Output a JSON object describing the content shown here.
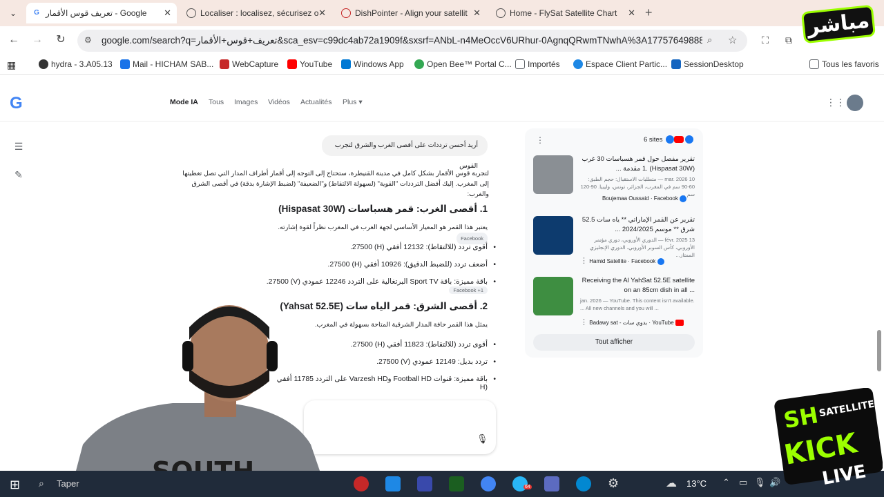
{
  "tabs": [
    {
      "title": "تعريف قوس الأقمار - Google Search",
      "display": "تعريف قوس الأقمار - Google",
      "active": true
    },
    {
      "title": "Localiser : localisez, sécurisez o",
      "active": false
    },
    {
      "title": "DishPointer - Align your satellit",
      "active": false
    },
    {
      "title": "Home - FlySat Satellite Chart",
      "active": false
    }
  ],
  "toolbar": {
    "url": "google.com/search?q=تعريف+قوس+الأقمار&sca_esv=c99dc4ab72a1909f&sxsrf=ANbL-n4MeOccV6URhur-0AgnqQRwmTNwhA%3A1775764988835..."
  },
  "bookmarks": [
    {
      "label": "hydra - 3.A05.13",
      "color": "#333333"
    },
    {
      "label": "Mail - HICHAM SAB...",
      "color": "#1a73e8"
    },
    {
      "label": "WebCapture",
      "color": "#c62828"
    },
    {
      "label": "YouTube",
      "color": "#ff0000"
    },
    {
      "label": "Windows App",
      "color": "#0078d4"
    },
    {
      "label": "Open Bee™ Portal C...",
      "color": "#34a853"
    },
    {
      "label": "Importés",
      "color": "#5f6368"
    },
    {
      "label": "Espace Client Partic...",
      "color": "#1e88e5"
    },
    {
      "label": "SessionDesktop",
      "color": "#1565c0"
    }
  ],
  "bookmarks_all": "Tous les favoris",
  "google": {
    "tabs": [
      "Mode IA",
      "Tous",
      "Images",
      "Vidéos",
      "Actualités",
      "Plus"
    ]
  },
  "content": {
    "prompt": "أريد أحسن ترددات على أقصى الغرب والشرق لتجرب القوس",
    "intro": "لتجربة قوس الأقمار بشكل كامل في مدينة القنيطرة، ستحتاج إلى التوجه إلى أقمار أطراف المدار التي تصل تغطيتها إلى المغرب. إليك أفضل الترددات \"القوية\" (لسهولة الالتقاط) و\"الضعيفة\" (لضبط الإشارة بدقة) في أقصى الشرق والغرب:",
    "section1_title": "1. أقصى الغرب: قمر هسباسات (Hispasat 30W)",
    "section1_desc": "يعتبر هذا القمر هو المعيار الأساسي لجهة الغرب في المغرب نظراً لقوة إشارته.",
    "section1_items": [
      "أقوى تردد (للالتقاط): 12132 أفقي (H) 27500.",
      "أضعف تردد (للضبط الدقيق): 10926 أفقي (H) 27500.",
      "باقة مميزة: باقة Sport TV البرتغالية على التردد 12246 عمودي (V) 27500."
    ],
    "section2_title": "2. أقصى الشرق: قمر الياه سات (Yahsat 52.5E)",
    "section2_desc": "يمثل هذا القمر حافة المدار الشرقية المتاحة بسهولة في المغرب.",
    "section2_items": [
      "أقوى تردد (للالتقاط): 11823 أفقي (H) 27500.",
      "تردد بديل: 12149 عمودي (V) 27500.",
      "باقة مميزة: قنوات Football HD وVarzesh HD على التردد 11785 أفقي (H"
    ],
    "chip1": "Facebook",
    "chip2": "Facebook +1"
  },
  "panel": {
    "sites_label": "6 sites",
    "cards": [
      {
        "title": "تقرير مفصل حول قمر هسباسات 30 غرب (Hispasat 30W) .1 مقدمة ...",
        "snippet": "10 mar. 2026 — متطلبات الاستقبال: حجم الطبق: 60-90 سم في المغرب، الجزائر، تونس، وليبيا. 90-120 سم ...",
        "source": "Boujemaa Oussaid · Facebook"
      },
      {
        "title": "تقرير عن القمر الإماراتي ** ياه سات 52.5 شرق ** موسم 2024/2025 ...",
        "snippet": "13 févr. 2025 — الدوري الأوروبي، دوري مؤتمر الأوروبي، كأس السوبر الأوروبي، الدوري الإنجليزي الممتاز...",
        "source": "Hamid Satellite · Facebook"
      },
      {
        "title": "Receiving the Al YahSat 52.5E satellite on an 85cm dish in all ...",
        "snippet": "jan. 2026 — YouTube. This content isn't available. ... All new channels and you will ...",
        "source": "Badawy sat - بدوي سات · YouTube"
      }
    ],
    "show_all": "Tout afficher"
  },
  "taskbar": {
    "search": "Taper",
    "temperature": "13°C",
    "telegram_badge": "64"
  },
  "overlay": {
    "live_badge": "مباشر",
    "brand_line1": "SH",
    "brand_line2": "SATELLITE",
    "brand_line3": "KICK",
    "brand_line4": "LIVE",
    "shirt": "SOUTH"
  },
  "colors": {
    "accent": "#1a73e8",
    "kick_green": "#9cff00",
    "taskbar": "#202b3a"
  }
}
